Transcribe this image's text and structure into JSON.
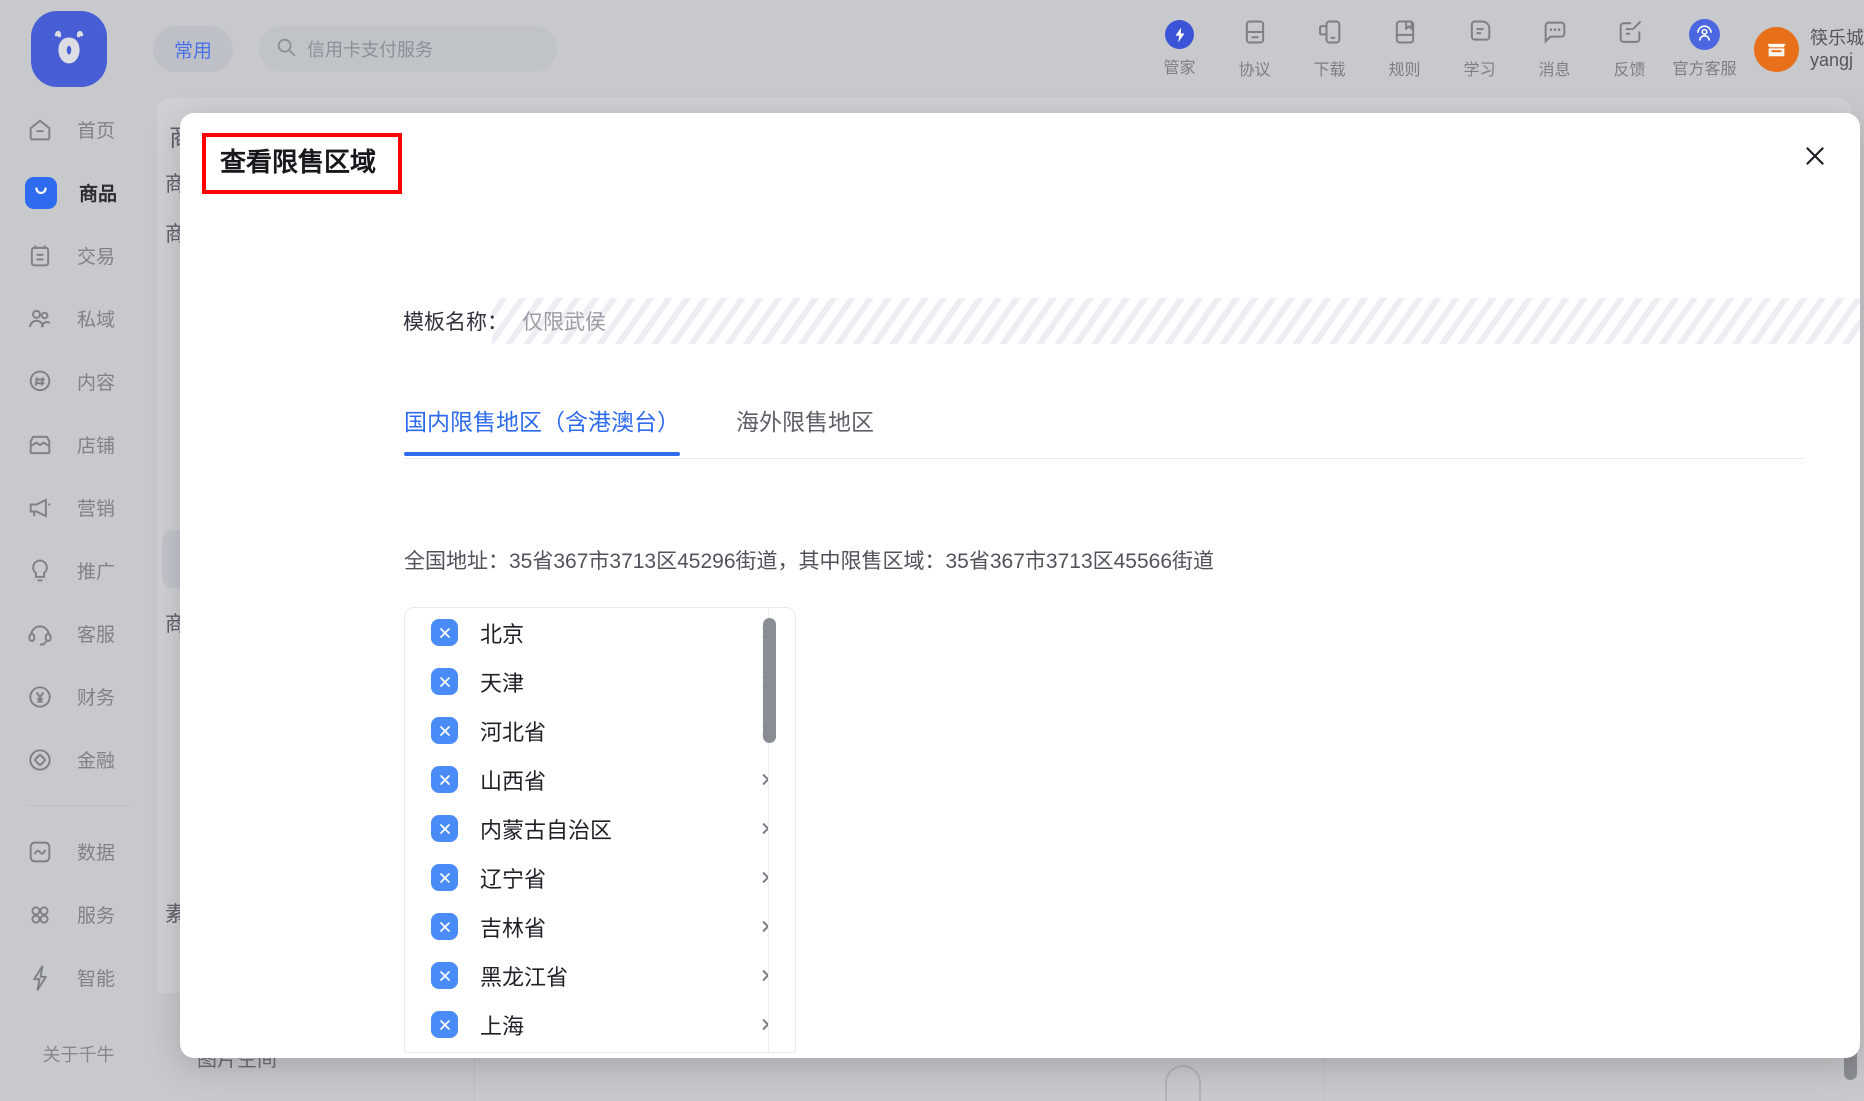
{
  "topbar": {
    "brand_icon": "qianniu-logo-icon",
    "common_tab": "常用",
    "search": {
      "placeholder": "信用卡支付服务",
      "icon": "search-icon"
    },
    "nav_items": [
      {
        "label": "管家",
        "icon": "butler-icon",
        "accent": true
      },
      {
        "label": "协议",
        "icon": "agreement-icon",
        "accent": false
      },
      {
        "label": "下载",
        "icon": "download-icon",
        "accent": false
      },
      {
        "label": "规则",
        "icon": "rules-book-icon",
        "accent": false
      },
      {
        "label": "学习",
        "icon": "learning-doc-icon",
        "accent": false
      },
      {
        "label": "消息",
        "icon": "message-bubble-icon",
        "accent": false
      },
      {
        "label": "反馈",
        "icon": "feedback-edit-icon",
        "accent": false
      },
      {
        "label": "官方客服",
        "icon": "headset-support-icon",
        "accent": false
      }
    ],
    "user": {
      "shop_name": "筷乐城",
      "account": "yangj",
      "avatar_icon": "shop-avatar-icon"
    }
  },
  "sidebar": {
    "items": [
      {
        "label": "首页",
        "icon": "home-icon",
        "active": false
      },
      {
        "label": "商品",
        "icon": "goods-icon",
        "active": true
      },
      {
        "label": "交易",
        "icon": "trade-icon",
        "active": false
      },
      {
        "label": "私域",
        "icon": "private-domain-icon",
        "active": false
      },
      {
        "label": "内容",
        "icon": "content-icon",
        "active": false
      },
      {
        "label": "店铺",
        "icon": "shop-icon",
        "active": false
      },
      {
        "label": "营销",
        "icon": "marketing-megaphone-icon",
        "active": false
      },
      {
        "label": "推广",
        "icon": "promotion-bulb-icon",
        "active": false
      },
      {
        "label": "客服",
        "icon": "customer-service-icon",
        "active": false
      },
      {
        "label": "财务",
        "icon": "finance-yuan-icon",
        "active": false
      },
      {
        "label": "金融",
        "icon": "financial-coin-icon",
        "active": false
      }
    ],
    "items2": [
      {
        "label": "数据",
        "icon": "data-chart-icon",
        "active": false
      },
      {
        "label": "服务",
        "icon": "service-grid-icon",
        "active": false
      },
      {
        "label": "智能",
        "icon": "ai-bolt-icon",
        "active": false
      }
    ],
    "footer": "关于千牛"
  },
  "background": {
    "texts": [
      "商",
      "商",
      "商",
      "商",
      "素"
    ],
    "bottom_label": "图片空间"
  },
  "modal": {
    "title": "查看限售区域",
    "title_highlight_color": "#fe0000",
    "close_icon": "close-icon",
    "template_label": "模板名称：",
    "template_value": "仅限武侯",
    "tabs": [
      {
        "label": "国内限售地区（含港澳台）",
        "active": true
      },
      {
        "label": "海外限售地区",
        "active": false
      }
    ],
    "summary": "全国地址：35省367市3713区45296街道，其中限售区域：35省367市3713区45566街道",
    "accent_color": "#2f6bef",
    "checkbox_color": "#4a8cf7",
    "regions": [
      {
        "name": "北京",
        "checked": true
      },
      {
        "name": "天津",
        "checked": true
      },
      {
        "name": "河北省",
        "checked": true
      },
      {
        "name": "山西省",
        "checked": true
      },
      {
        "name": "内蒙古自治区",
        "checked": true
      },
      {
        "name": "辽宁省",
        "checked": true
      },
      {
        "name": "吉林省",
        "checked": true
      },
      {
        "name": "黑龙江省",
        "checked": true
      },
      {
        "name": "上海",
        "checked": true
      }
    ]
  }
}
